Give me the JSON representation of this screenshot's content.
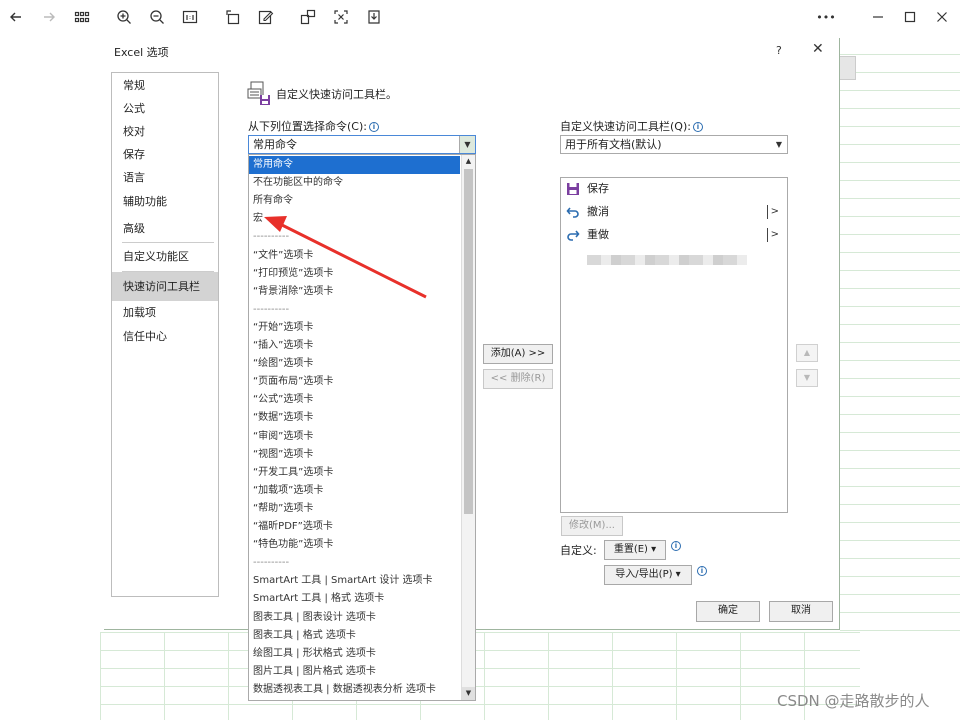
{
  "toolbar": {
    "icons": [
      "back-icon",
      "forward-icon",
      "grid-view-icon",
      "zoom-in-icon",
      "zoom-out-icon",
      "actual-size-icon",
      "rotate-icon",
      "edit-icon",
      "crop-icon",
      "fit-screen-icon",
      "save-icon",
      "more-icon",
      "minimize-icon",
      "maximize-icon",
      "close-icon"
    ],
    "more_label": "•••"
  },
  "dialog": {
    "title": "Excel 选项",
    "help_label": "?",
    "close_label": "✕",
    "nav_items": [
      "常规",
      "公式",
      "校对",
      "保存",
      "语言",
      "辅助功能",
      "高级",
      "自定义功能区",
      "快速访问工具栏",
      "加载项",
      "信任中心"
    ],
    "section_title": "自定义快速访问工具栏。",
    "choose_from_label": "从下列位置选择命令(C):",
    "choose_from_value": "常用命令",
    "customize_label": "自定义快速访问工具栏(Q):",
    "customize_value": "用于所有文档(默认)",
    "dropdown_options": [
      "常用命令",
      "不在功能区中的命令",
      "所有命令",
      "宏",
      "----------",
      "“文件”选项卡",
      "“打印预览”选项卡",
      "“背景消除”选项卡",
      "----------",
      "“开始”选项卡",
      "“插入”选项卡",
      "“绘图”选项卡",
      "“页面布局”选项卡",
      "“公式”选项卡",
      "“数据”选项卡",
      "“审阅”选项卡",
      "“视图”选项卡",
      "“开发工具”选项卡",
      "“加载项”选项卡",
      "“帮助”选项卡",
      "“福昕PDF”选项卡",
      "“特色功能”选项卡",
      "----------",
      "SmartArt 工具 | SmartArt 设计 选项卡",
      "SmartArt 工具 | 格式 选项卡",
      "图表工具 | 图表设计 选项卡",
      "图表工具 | 格式 选项卡",
      "绘图工具 | 形状格式 选项卡",
      "图片工具 | 图片格式 选项卡",
      "数据透视表工具 | 数据透视表分析 选项卡"
    ],
    "qa_items": [
      {
        "label": "保存",
        "icon": "save-icon",
        "has_sub": false
      },
      {
        "label": "撤消",
        "icon": "undo-icon",
        "has_sub": true
      },
      {
        "label": "重做",
        "icon": "redo-icon",
        "has_sub": true
      }
    ],
    "sub_arrow": ">",
    "add_button": "添加(A) >>",
    "remove_button": "<< 删除(R)",
    "modify_button": "修改(M)...",
    "customize_row_label": "自定义:",
    "reset_button": "重置(E) ▾",
    "import_export_button": "导入/导出(P) ▾",
    "ok_button": "确定",
    "cancel_button": "取消",
    "move_up": "▲",
    "move_down": "▼",
    "combo_arrow": "▼",
    "info_glyph": "i"
  },
  "watermark": "CSDN @走路散步的人",
  "colors": {
    "selection": "#1e6fd0",
    "annotation_arrow": "#e8302a",
    "grid": "#d6e9d6"
  }
}
